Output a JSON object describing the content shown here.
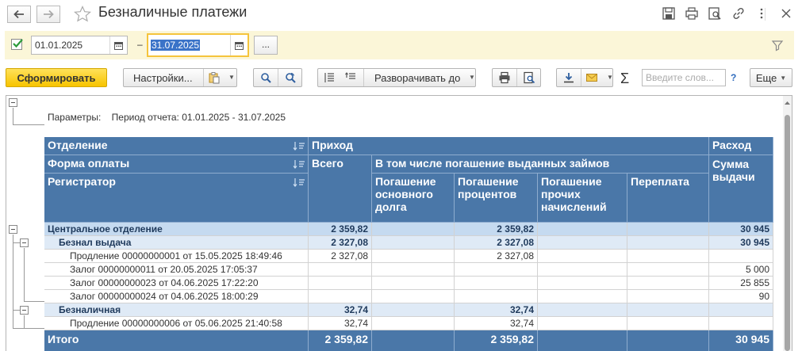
{
  "window": {
    "title": "Безналичные платежи"
  },
  "filter": {
    "date_from": "01.01.2025",
    "date_to": "31.07.2025",
    "separator": "–",
    "more_label": "..."
  },
  "toolbar": {
    "generate_label": "Сформировать",
    "settings_label": "Настройки...",
    "expand_label": "Разворачивать до",
    "sigma": "Σ",
    "search_placeholder": "Введите слов...",
    "help_label": "?",
    "more_label": "Еще"
  },
  "report": {
    "params_label": "Параметры:",
    "period_text": "Период отчета: 01.01.2025 - 31.07.2025",
    "headers": {
      "department": "Отделение",
      "payment_form": "Форма оплаты",
      "registrar": "Регистратор",
      "income": "Приход",
      "total_col": "Всего",
      "incl_loans": "В том числе погашение выданных займов",
      "principal": "Погашение основного долга",
      "interest": "Погашение процентов",
      "other": "Погашение прочих начислений",
      "overpay": "Переплата",
      "expense": "Расход",
      "issued_sum": "Сумма выдачи"
    },
    "rows": [
      {
        "label": "Центральное отделение",
        "total": "2 359,82",
        "principal": "",
        "interest": "2 359,82",
        "other": "",
        "overpay": "",
        "issued": "30 945"
      },
      {
        "label": "Безнал выдача",
        "total": "2 327,08",
        "principal": "",
        "interest": "2 327,08",
        "other": "",
        "overpay": "",
        "issued": "30 945"
      },
      {
        "label": "Продление 00000000001 от 15.05.2025 18:49:46",
        "total": "2 327,08",
        "principal": "",
        "interest": "2 327,08",
        "other": "",
        "overpay": "",
        "issued": ""
      },
      {
        "label": "Залог 00000000011 от 20.05.2025 17:05:37",
        "total": "",
        "principal": "",
        "interest": "",
        "other": "",
        "overpay": "",
        "issued": "5 000"
      },
      {
        "label": "Залог 00000000023 от 04.06.2025 17:22:20",
        "total": "",
        "principal": "",
        "interest": "",
        "other": "",
        "overpay": "",
        "issued": "25 855"
      },
      {
        "label": "Залог 00000000024 от 04.06.2025 18:00:29",
        "total": "",
        "principal": "",
        "interest": "",
        "other": "",
        "overpay": "",
        "issued": "90"
      },
      {
        "label": "Безналичная",
        "total": "32,74",
        "principal": "",
        "interest": "32,74",
        "other": "",
        "overpay": "",
        "issued": ""
      },
      {
        "label": "Продление 00000000006 от 05.06.2025 21:40:58",
        "total": "32,74",
        "principal": "",
        "interest": "32,74",
        "other": "",
        "overpay": "",
        "issued": ""
      }
    ],
    "totals": {
      "label": "Итого",
      "total": "2 359,82",
      "interest": "2 359,82",
      "issued": "30 945"
    }
  },
  "colors": {
    "header_bg": "#4a77a8",
    "group1_bg": "#c5daf0",
    "group2_bg": "#dfeaf6",
    "primary_button": "#f7c400",
    "filter_bar_bg": "#fbf6d8"
  }
}
